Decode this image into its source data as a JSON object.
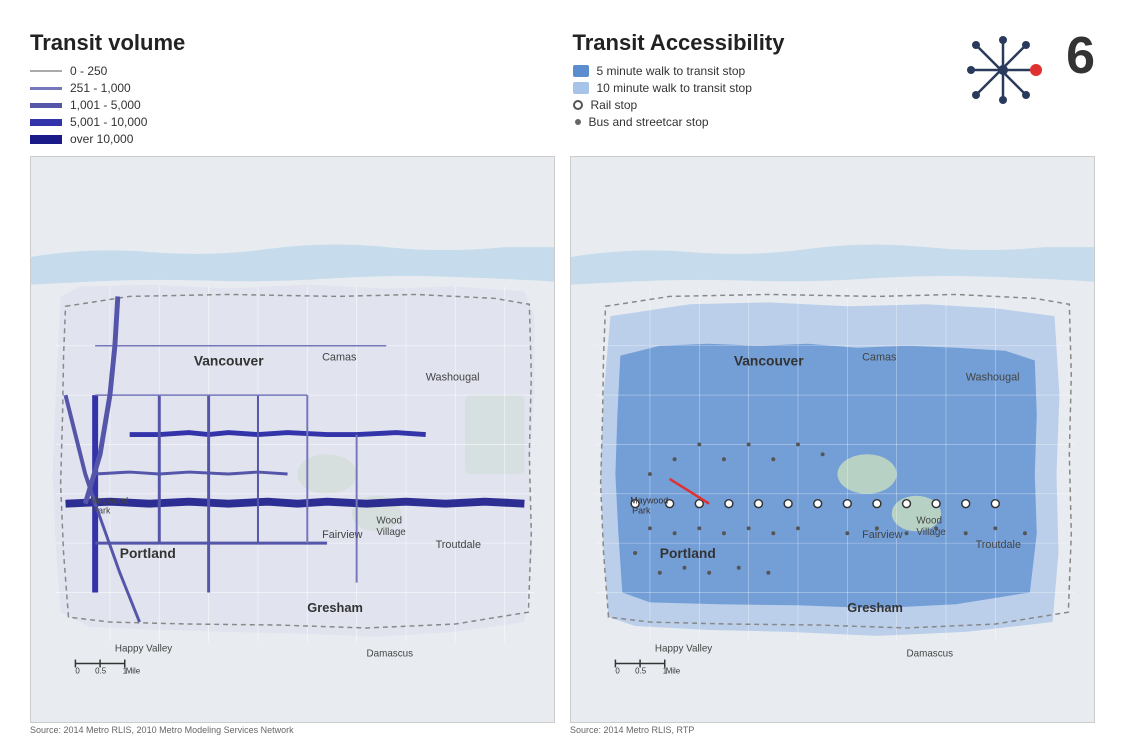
{
  "left": {
    "title": "Transit volume",
    "legend": [
      {
        "label": "0 - 250",
        "color": "#aaa",
        "thickness": 1
      },
      {
        "label": "251 - 1,000",
        "color": "#7777bb",
        "thickness": 2
      },
      {
        "label": "1,001 - 5,000",
        "color": "#5555aa",
        "thickness": 3
      },
      {
        "label": "5,001 - 10,000",
        "color": "#3333aa",
        "thickness": 5
      },
      {
        "label": "over 10,000",
        "color": "#1a1a88",
        "thickness": 7
      }
    ],
    "source": "Source: 2014 Metro RLIS, 2010 Metro Modeling Services Network"
  },
  "right": {
    "title": "Transit Accessibility",
    "legend": [
      {
        "label": "5 minute walk to transit stop",
        "type": "square",
        "color": "#5b8ecf"
      },
      {
        "label": "10 minute walk to transit stop",
        "type": "square",
        "color": "#a8c3e8"
      },
      {
        "label": "Rail stop",
        "type": "dot-outline",
        "color": "#fff",
        "border": "#555"
      },
      {
        "label": "Bus and streetcar stop",
        "type": "dot-small",
        "color": "#666"
      }
    ],
    "source": "Source: 2014 Metro RLIS, RTP"
  },
  "page_number": "6",
  "place_labels": {
    "vancouver": "Vancouver",
    "camas": "Camas",
    "washougal": "Washougal",
    "portland": "Portland",
    "fairview": "Fairview",
    "wood_village": "Wood Village",
    "troutdale": "Troutdale",
    "gresham": "Gresham",
    "happy_valley": "Happy Valley",
    "damascus": "Damascus",
    "maywood_park": "Maywood Park"
  }
}
